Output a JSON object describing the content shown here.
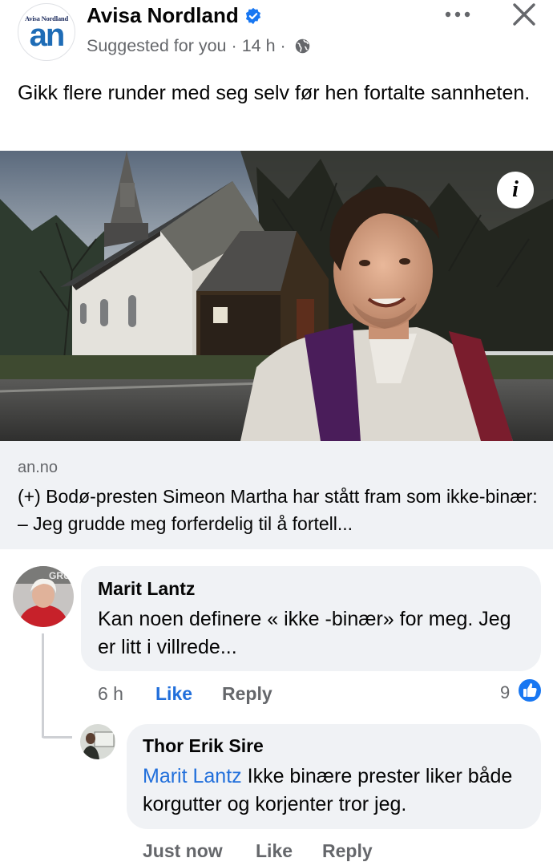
{
  "page": {
    "name": "Avisa Nordland",
    "logo_small": "Avisa Nordland",
    "logo_big": "an",
    "suggested": "Suggested for you",
    "time": "14 h",
    "separator": "·"
  },
  "post": {
    "text": "Gikk flere runder med seg selv før hen fortalte sannheten."
  },
  "photo": {
    "info_label": "i"
  },
  "link": {
    "domain": "an.no",
    "title": "(+) Bodø-presten Simeon Martha har stått fram som ikke-binær: – Jeg grudde meg forferdelig til å fortell..."
  },
  "comments": [
    {
      "author": "Marit Lantz",
      "text": "Kan noen definere « ikke -binær» for meg. Jeg er litt i villrede...",
      "time": "6 h",
      "like_label": "Like",
      "reply_label": "Reply",
      "reactions": "9"
    },
    {
      "author": "Thor Erik Sire",
      "mention": "Marit Lantz",
      "text": " Ikke binære prester liker både korgutter og korjenter tror jeg.",
      "time": "Just now",
      "like_label": "Like",
      "reply_label": "Reply"
    }
  ],
  "colors": {
    "accent": "#216fdb",
    "verified": "#1877f2",
    "secondary_text": "#65676b",
    "bubble": "#f0f2f5"
  },
  "icons": [
    "verified-badge-icon",
    "globe-icon",
    "more-icon",
    "close-icon",
    "info-icon",
    "like-reaction-icon"
  ]
}
